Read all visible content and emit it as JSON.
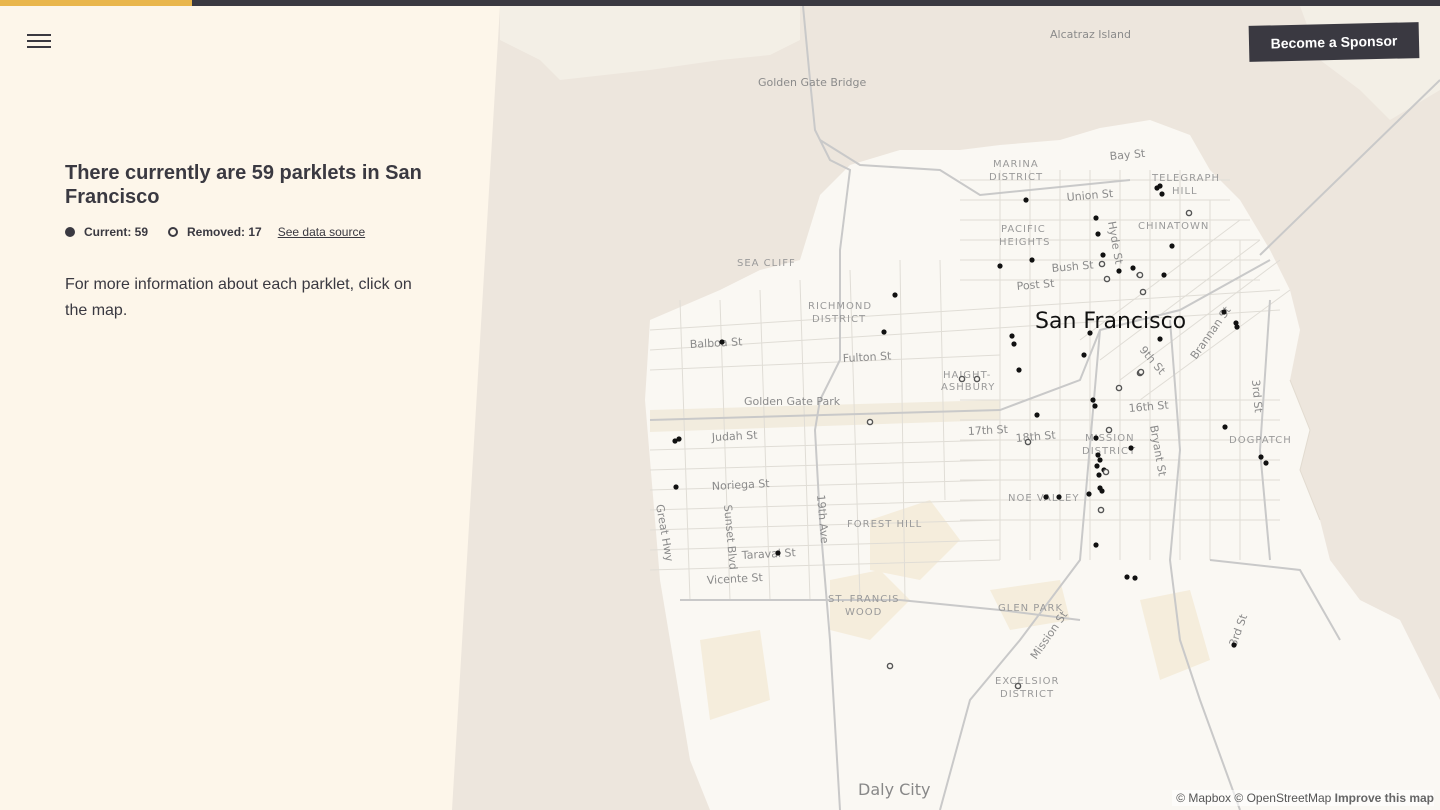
{
  "header": {
    "progress_fraction": 0.133
  },
  "menu": {
    "icon": "hamburger-icon"
  },
  "sponsor": {
    "label": "Become a Sponsor"
  },
  "panel": {
    "headline": "There currently are 59 parklets in San Francisco",
    "legend": {
      "current_label": "Current: 59",
      "removed_label": "Removed: 17",
      "source_link": "See data source"
    },
    "info": "For more information about each parklet, click on the map."
  },
  "map": {
    "labels": {
      "alcatraz": "Alcatraz Island",
      "golden_gate_bridge": "Golden Gate Bridge",
      "bay_st": "Bay St",
      "marina_1": "MARINA",
      "marina_2": "DISTRICT",
      "telegraph_1": "TELEGRAPH",
      "telegraph_2": "HILL",
      "union_st": "Union St",
      "pacific_1": "PACIFIC",
      "pacific_2": "HEIGHTS",
      "chinatown": "CHINATOWN",
      "hyde_st": "Hyde St",
      "sea_cliff": "SEA CLIFF",
      "bush_st": "Bush St",
      "post_st": "Post St",
      "richmond_1": "RICHMOND",
      "richmond_2": "DISTRICT",
      "san_francisco": "San Francisco",
      "balboa_st": "Balboa St",
      "fulton_st": "Fulton St",
      "brannan_st": "Brannan St",
      "ninth_st": "9th St",
      "haight_1": "HAIGHT-",
      "haight_2": "ASHBURY",
      "golden_gate_park": "Golden Gate Park",
      "sixteenth_st": "16th St",
      "third_st": "3rd St",
      "seventeenth_st": "17th St",
      "eighteenth_st": "18th St",
      "mission_1": "MISSION",
      "mission_2": "DISTRICT",
      "bryant_st": "Bryant St",
      "dogpatch": "DOGPATCH",
      "judah_st": "Judah St",
      "noriega_st": "Noriega St",
      "noe_valley": "NOE VALLEY",
      "great_hwy": "Great Hwy",
      "sunset_blvd": "Sunset Blvd",
      "nineteenth_ave": "19th Ave",
      "forest_hill": "FOREST HILL",
      "taraval_st": "Taraval St",
      "vicente_st": "Vicente St",
      "st_francis_1": "ST. FRANCIS",
      "st_francis_2": "WOOD",
      "glen_park": "GLEN PARK",
      "mission_st": "Mission St",
      "third_st_south": "3rd St",
      "excelsior_1": "EXCELSIOR",
      "excelsior_2": "DISTRICT",
      "daly_city": "Daly City"
    },
    "colors": {
      "water": "#ede6dd",
      "land": "#faf8f3",
      "park": "#f5efe2",
      "road": "#cfcfcf",
      "marker": "#111111"
    },
    "parklets_current": [
      [
        1026,
        200
      ],
      [
        1157,
        188
      ],
      [
        1160,
        186
      ],
      [
        1162,
        194
      ],
      [
        1096,
        218
      ],
      [
        1098,
        234
      ],
      [
        1172,
        246
      ],
      [
        1000,
        266
      ],
      [
        1032,
        260
      ],
      [
        1119,
        271
      ],
      [
        1133,
        268
      ],
      [
        1164,
        275
      ],
      [
        1139,
        275
      ],
      [
        1103,
        255
      ],
      [
        895,
        295
      ],
      [
        1012,
        336
      ],
      [
        1014,
        344
      ],
      [
        1090,
        333
      ],
      [
        884,
        332
      ],
      [
        722,
        342
      ],
      [
        1084,
        355
      ],
      [
        1160,
        339
      ],
      [
        1224,
        312
      ],
      [
        1236,
        323
      ],
      [
        1237,
        327
      ],
      [
        1019,
        370
      ],
      [
        1093,
        400
      ],
      [
        1095,
        406
      ],
      [
        1037,
        415
      ],
      [
        1225,
        427
      ],
      [
        1096,
        438
      ],
      [
        1131,
        448
      ],
      [
        1098,
        455
      ],
      [
        1100,
        460
      ],
      [
        1097,
        466
      ],
      [
        1099,
        475
      ],
      [
        1104,
        470
      ],
      [
        1100,
        488
      ],
      [
        1102,
        491
      ],
      [
        1089,
        494
      ],
      [
        1046,
        497
      ],
      [
        1059,
        497
      ],
      [
        675,
        441
      ],
      [
        679,
        439
      ],
      [
        676,
        487
      ],
      [
        778,
        553
      ],
      [
        1096,
        545
      ],
      [
        1127,
        577
      ],
      [
        1135,
        578
      ],
      [
        1234,
        645
      ],
      [
        1261,
        457
      ],
      [
        1266,
        463
      ]
    ],
    "parklets_removed": [
      [
        1189,
        213
      ],
      [
        1102,
        264
      ],
      [
        1107,
        279
      ],
      [
        1140,
        275
      ],
      [
        1143,
        292
      ],
      [
        962,
        379
      ],
      [
        977,
        379
      ],
      [
        1140,
        373
      ],
      [
        1119,
        388
      ],
      [
        870,
        422
      ],
      [
        1109,
        430
      ],
      [
        1028,
        442
      ],
      [
        1106,
        472
      ],
      [
        1101,
        510
      ],
      [
        890,
        666
      ],
      [
        1018,
        686
      ],
      [
        1141,
        372
      ]
    ]
  },
  "attribution": {
    "mapbox": "© Mapbox",
    "osm": "© OpenStreetMap",
    "improve": "Improve this map"
  }
}
